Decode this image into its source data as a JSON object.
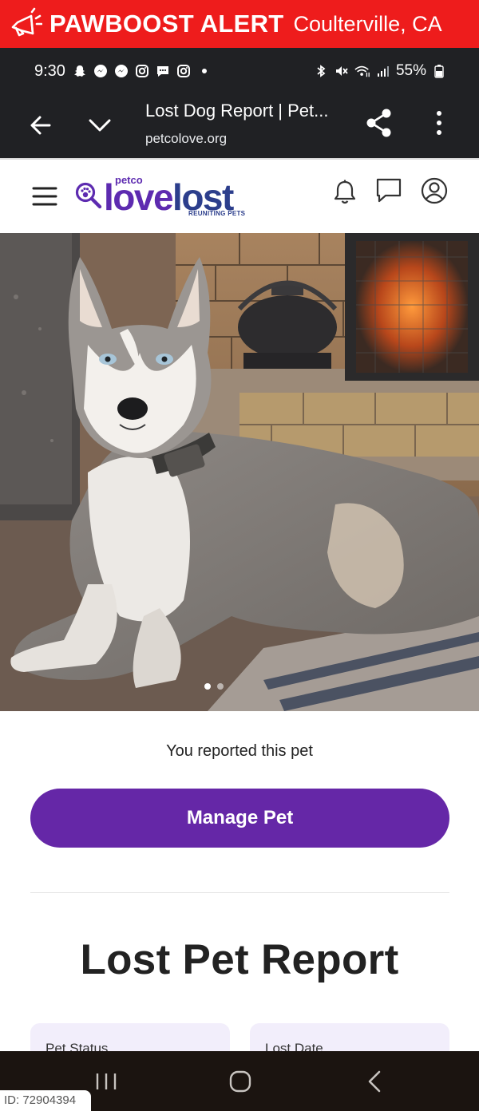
{
  "alert": {
    "title": "PAWBOOST ALERT",
    "location": "Coulterville, CA",
    "icon": "megaphone-icon"
  },
  "status_bar": {
    "time": "9:30",
    "battery": "55%",
    "left_icons": [
      "snapchat-icon",
      "messenger-icon",
      "messenger-icon",
      "instagram-icon",
      "chat-bubble-icon",
      "instagram-icon",
      "dot-icon"
    ],
    "right_icons": [
      "bluetooth-icon",
      "mute-icon",
      "wifi-icon",
      "signal-icon",
      "battery-icon"
    ]
  },
  "browser": {
    "title": "Lost Dog Report | Pet...",
    "url": "petcolove.org"
  },
  "site_header": {
    "logo_petco": "petco",
    "logo_love": "love",
    "logo_lost": "lost",
    "logo_tagline": "REUNITING PETS"
  },
  "photo": {
    "subject": "husky-photo",
    "slide_count": 2,
    "active_slide": 1
  },
  "content": {
    "reported_text": "You reported this pet",
    "manage_button": "Manage Pet",
    "report_title": "Lost Pet Report",
    "cards": [
      {
        "label": "Pet Status"
      },
      {
        "label": "Lost Date"
      }
    ]
  },
  "footer": {
    "id_label": "ID: 72904394"
  },
  "colors": {
    "alert_red": "#ee1c1c",
    "chrome_dark": "#202124",
    "brand_purple": "#6527a7",
    "card_tint": "#f2eefb"
  }
}
